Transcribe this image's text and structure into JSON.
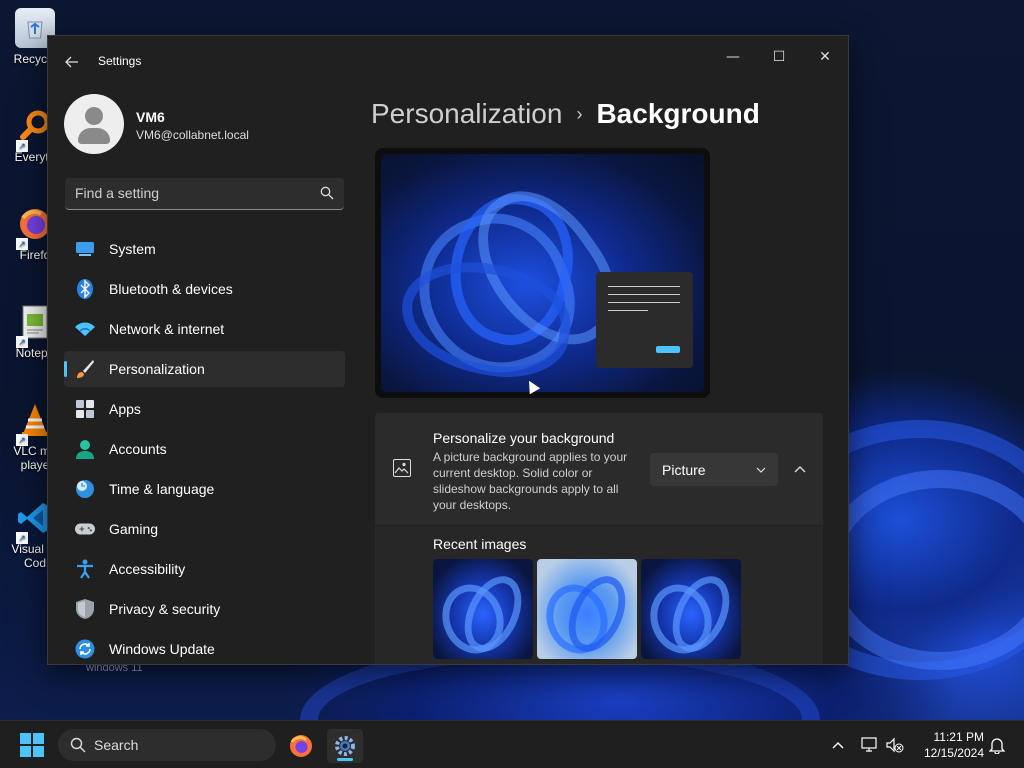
{
  "desktop": {
    "icons": [
      {
        "label": "Recycle",
        "icon": "recycle-bin-icon"
      },
      {
        "label": "Everyth",
        "icon": "everything-search-icon"
      },
      {
        "label": "Firefo",
        "icon": "firefox-icon"
      },
      {
        "label": "Notepa",
        "icon": "notepad-icon"
      },
      {
        "label": "VLC me\nplaye",
        "icon": "vlc-icon"
      },
      {
        "label": "Visual St\nCod",
        "icon": "vscode-icon"
      }
    ],
    "wallpaper_text": "windows 11"
  },
  "window": {
    "title": "Settings",
    "controls": {
      "minimize": "—",
      "maximize": "☐",
      "close": "✕"
    }
  },
  "user": {
    "name": "VM6",
    "email": "VM6@collabnet.local"
  },
  "search": {
    "placeholder": "Find a setting"
  },
  "nav": {
    "items": [
      {
        "label": "System",
        "icon": "system-icon"
      },
      {
        "label": "Bluetooth & devices",
        "icon": "bluetooth-icon"
      },
      {
        "label": "Network & internet",
        "icon": "network-icon"
      },
      {
        "label": "Personalization",
        "icon": "personalization-brush-icon",
        "selected": true
      },
      {
        "label": "Apps",
        "icon": "apps-icon"
      },
      {
        "label": "Accounts",
        "icon": "accounts-icon"
      },
      {
        "label": "Time & language",
        "icon": "time-language-icon"
      },
      {
        "label": "Gaming",
        "icon": "gaming-icon"
      },
      {
        "label": "Accessibility",
        "icon": "accessibility-icon"
      },
      {
        "label": "Privacy & security",
        "icon": "shield-icon"
      },
      {
        "label": "Windows Update",
        "icon": "windows-update-icon"
      }
    ]
  },
  "main": {
    "breadcrumb": {
      "parent": "Personalization",
      "separator": "›",
      "current": "Background"
    },
    "background_card": {
      "title": "Personalize your background",
      "description": "A picture background applies to your current desktop. Solid color or slideshow backgrounds apply to all your desktops.",
      "dropdown_value": "Picture",
      "expanded": true
    },
    "recent_images": {
      "title": "Recent images"
    }
  },
  "taskbar": {
    "search_label": "Search",
    "time": "11:21 PM",
    "date": "12/15/2024"
  },
  "colors": {
    "accent": "#4cc2ff",
    "window_bg": "#202020",
    "card_bg": "#2b2b2b"
  }
}
